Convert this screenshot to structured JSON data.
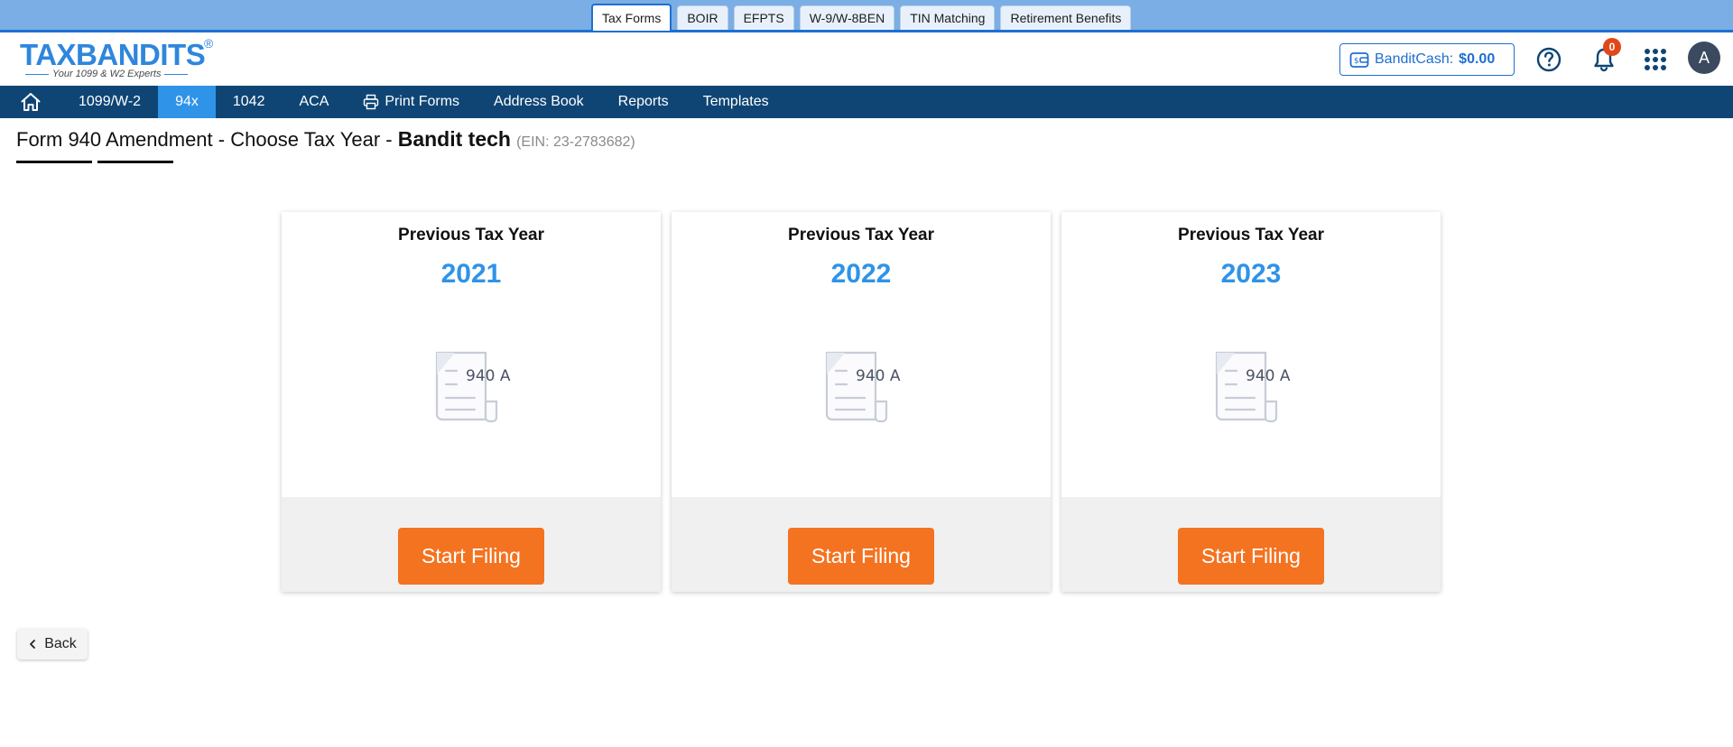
{
  "product_tabs": [
    {
      "label": "Tax Forms",
      "active": true
    },
    {
      "label": "BOIR",
      "active": false
    },
    {
      "label": "EFPTS",
      "active": false
    },
    {
      "label": "W-9/W-8BEN",
      "active": false
    },
    {
      "label": "TIN Matching",
      "active": false
    },
    {
      "label": "Retirement Benefits",
      "active": false
    }
  ],
  "header": {
    "logo_text": "TAXBANDITS",
    "logo_reg": "®",
    "logo_tagline": "Your 1099 & W2 Experts",
    "bandit_cash_label": "BanditCash:",
    "bandit_cash_amount": "$0.00",
    "notification_count": "0",
    "avatar_initial": "A"
  },
  "nav": {
    "items": [
      "1099/W-2",
      "94x",
      "1042",
      "ACA",
      "Print Forms",
      "Address Book",
      "Reports",
      "Templates"
    ],
    "active": "94x"
  },
  "page": {
    "title": "Form 940 Amendment - Choose Tax Year",
    "company_prefix": " - ",
    "company": "Bandit tech",
    "ein": "(EIN: 23-2783682)"
  },
  "cards": [
    {
      "label": "Previous Tax Year",
      "year": "2021",
      "form_label": "940 A",
      "button": "Start Filing"
    },
    {
      "label": "Previous Tax Year",
      "year": "2022",
      "form_label": "940 A",
      "button": "Start Filing"
    },
    {
      "label": "Previous Tax Year",
      "year": "2023",
      "form_label": "940 A",
      "button": "Start Filing"
    }
  ],
  "back_button": {
    "label": "Back"
  },
  "colors": {
    "brand_blue": "#2f86dd",
    "nav_bg": "#0f4574",
    "nav_active": "#2f93e8",
    "accent_orange": "#f47320",
    "badge_red": "#e0481a"
  }
}
